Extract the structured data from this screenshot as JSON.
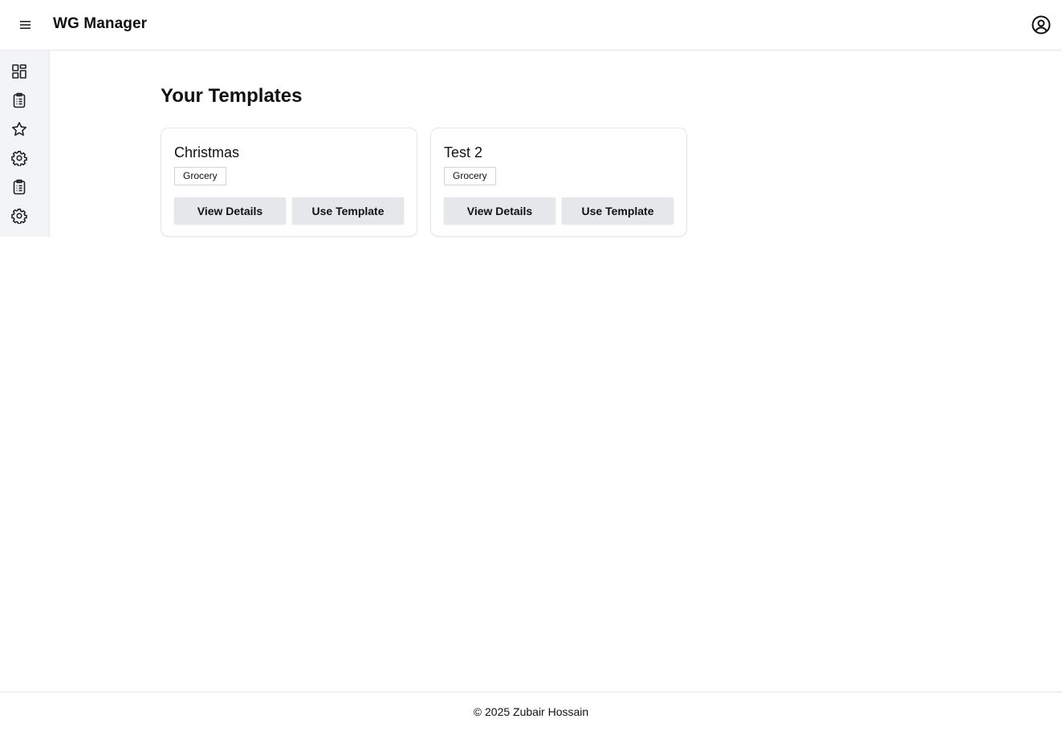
{
  "header": {
    "menu_icon": "hamburger-menu-icon",
    "title": "WG Manager",
    "account_icon": "user-circle-icon"
  },
  "sidebar": {
    "items": [
      {
        "icon": "dashboard-grid-icon"
      },
      {
        "icon": "clipboard-list-icon"
      },
      {
        "icon": "star-icon"
      },
      {
        "icon": "gear-icon"
      },
      {
        "icon": "clipboard-list-icon"
      },
      {
        "icon": "gear-icon"
      }
    ]
  },
  "main": {
    "title": "Your Templates",
    "templates": [
      {
        "name": "Christmas",
        "tag": "Grocery",
        "view_label": "View Details",
        "use_label": "Use Template"
      },
      {
        "name": "Test 2",
        "tag": "Grocery",
        "view_label": "View Details",
        "use_label": "Use Template"
      }
    ]
  },
  "footer": {
    "text": "© 2025 Zubair Hossain"
  },
  "colors": {
    "border": "#e5e7eb",
    "sidebar_bg": "#f3f4f6",
    "button_bg": "#e5e7eb",
    "text": "#111111"
  }
}
